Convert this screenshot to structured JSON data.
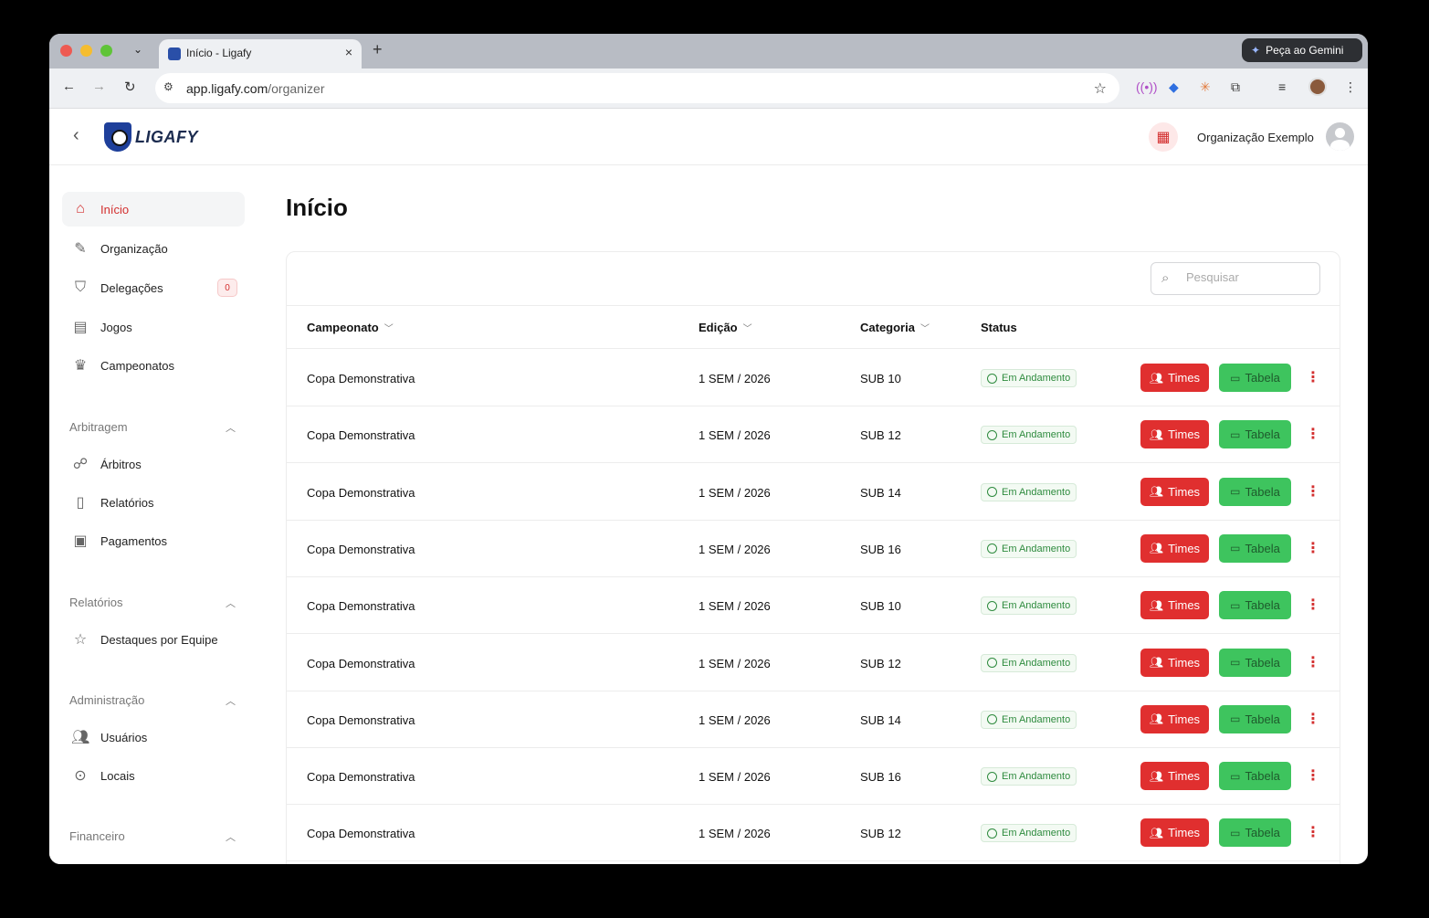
{
  "browser": {
    "tab_title": "Início - Ligafy",
    "tab_close": "×",
    "new_tab": "+",
    "gemini_label": "Peça ao Gemini",
    "url_host": "app.ligafy.com",
    "url_path": "/organizer"
  },
  "header": {
    "logo_text": "LIGAFY",
    "org_name": "Organização Exemplo"
  },
  "sidebar": {
    "items": [
      {
        "label": "Início",
        "icon": "home-icon",
        "active": true
      },
      {
        "label": "Organização",
        "icon": "edit-icon"
      },
      {
        "label": "Delegações",
        "icon": "shield-icon",
        "badge": "0"
      },
      {
        "label": "Jogos",
        "icon": "calendar-icon"
      },
      {
        "label": "Campeonatos",
        "icon": "trophy-icon"
      }
    ],
    "sections": [
      {
        "title": "Arbitragem",
        "items": [
          {
            "label": "Árbitros",
            "icon": "whistle-icon"
          },
          {
            "label": "Relatórios",
            "icon": "report-icon"
          },
          {
            "label": "Pagamentos",
            "icon": "money-icon"
          }
        ]
      },
      {
        "title": "Relatórios",
        "items": [
          {
            "label": "Destaques por Equipe",
            "icon": "star-icon"
          }
        ]
      },
      {
        "title": "Administração",
        "items": [
          {
            "label": "Usuários",
            "icon": "users-icon"
          },
          {
            "label": "Locais",
            "icon": "location-icon"
          }
        ]
      },
      {
        "title": "Financeiro",
        "items": []
      }
    ]
  },
  "main": {
    "title": "Início",
    "search_placeholder": "Pesquisar",
    "columns": [
      "Campeonato",
      "Edição",
      "Categoria",
      "Status"
    ],
    "times_label": "Times",
    "tabela_label": "Tabela",
    "rows": [
      {
        "campeonato": "Copa Demonstrativa",
        "edicao": "1 SEM / 2026",
        "categoria": "SUB 10",
        "status": "Em Andamento"
      },
      {
        "campeonato": "Copa Demonstrativa",
        "edicao": "1 SEM / 2026",
        "categoria": "SUB 12",
        "status": "Em Andamento"
      },
      {
        "campeonato": "Copa Demonstrativa",
        "edicao": "1 SEM / 2026",
        "categoria": "SUB 14",
        "status": "Em Andamento"
      },
      {
        "campeonato": "Copa Demonstrativa",
        "edicao": "1 SEM / 2026",
        "categoria": "SUB 16",
        "status": "Em Andamento"
      },
      {
        "campeonato": "Copa Demonstrativa",
        "edicao": "1 SEM / 2026",
        "categoria": "SUB 10",
        "status": "Em Andamento"
      },
      {
        "campeonato": "Copa Demonstrativa",
        "edicao": "1 SEM / 2026",
        "categoria": "SUB 12",
        "status": "Em Andamento"
      },
      {
        "campeonato": "Copa Demonstrativa",
        "edicao": "1 SEM / 2026",
        "categoria": "SUB 14",
        "status": "Em Andamento"
      },
      {
        "campeonato": "Copa Demonstrativa",
        "edicao": "1 SEM / 2026",
        "categoria": "SUB 16",
        "status": "Em Andamento"
      },
      {
        "campeonato": "Copa Demonstrativa",
        "edicao": "1 SEM / 2026",
        "categoria": "SUB 12",
        "status": "Em Andamento"
      }
    ]
  },
  "colors": {
    "accent_red": "#e02f2f",
    "accent_green": "#3ec45e",
    "status_green": "#2e8b3e"
  }
}
